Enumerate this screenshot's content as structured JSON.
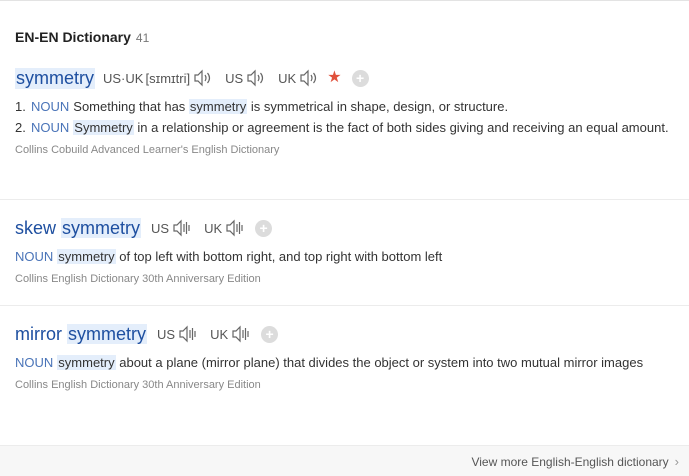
{
  "header": {
    "title": "EN-EN Dictionary",
    "count": "41"
  },
  "entry1": {
    "word": "symmetry",
    "us_uk_label": "US·UK",
    "phonetic": "[sɪmɪtri]",
    "us_label": "US",
    "uk_label": "UK",
    "definitions": [
      {
        "num": "1.",
        "pos": "NOUN",
        "pre": "Something that has ",
        "hl": "symmetry",
        "post": " is symmetrical in shape, design, or structure."
      },
      {
        "num": "2.",
        "pos": "NOUN",
        "pre": "",
        "hl": "Symmetry",
        "post": " in a relationship or agreement is the fact of both sides giving and receiving an equal amount."
      }
    ],
    "source": "Collins Cobuild Advanced Learner's English Dictionary"
  },
  "entry2": {
    "word_pre": "skew ",
    "word_hl": "symmetry",
    "us_label": "US",
    "uk_label": "UK",
    "pos": "NOUN",
    "hl": "symmetry",
    "post": " of top left with bottom right, and top right with bottom left",
    "source": "Collins English Dictionary 30th Anniversary Edition"
  },
  "entry3": {
    "word_pre": "mirror ",
    "word_hl": "symmetry",
    "us_label": "US",
    "uk_label": "UK",
    "pos": "NOUN",
    "hl": "symmetry",
    "post": " about a plane (mirror plane) that divides the object or system into two mutual mirror images",
    "source": "Collins English Dictionary 30th Anniversary Edition"
  },
  "footer": {
    "more_label": "View more English-English dictionary"
  },
  "icons": {
    "speaker": "speaker-icon",
    "star": "star-icon",
    "plus": "add-icon",
    "chevron": "chevron-right-icon"
  },
  "colors": {
    "word": "#1e4fa0",
    "pos": "#4a74b8",
    "highlight": "#e4eefb",
    "star": "#e0513c"
  }
}
